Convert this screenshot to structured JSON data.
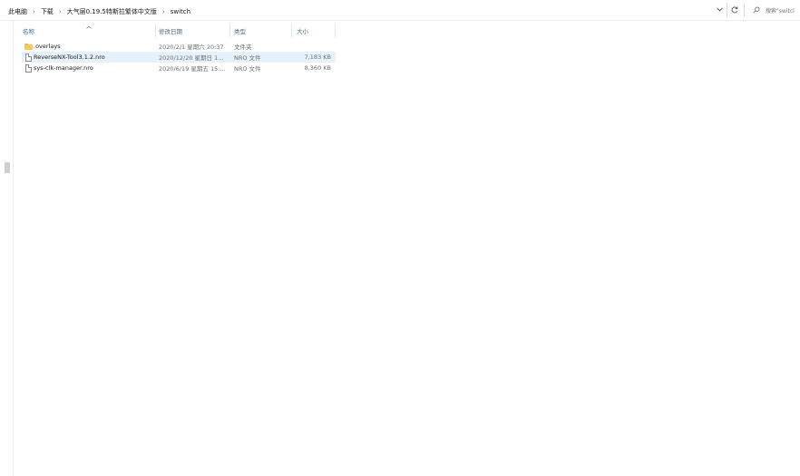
{
  "breadcrumb": {
    "items": [
      "此电脑",
      "下载",
      "大气层0.19.5特斯拉繁体中文版",
      "switch"
    ],
    "separator": "›"
  },
  "address_controls": {
    "dropdown_icon": "chevron-down-icon",
    "refresh_icon": "refresh-icon"
  },
  "search": {
    "placeholder": "搜索\"switcl",
    "icon": "search-icon"
  },
  "columns": {
    "name": "名称",
    "date": "修改日期",
    "type": "类型",
    "size": "大小"
  },
  "files": [
    {
      "name": ".overlays",
      "date": "2020/2/1 星期六 20:37",
      "type": "文件夹",
      "size": "",
      "icon": "folder-icon",
      "selected": false
    },
    {
      "name": "ReverseNX-Tool3.1.2.nro",
      "date": "2020/12/20 星期日 1...",
      "type": "NRO 文件",
      "size": "7,183 KB",
      "icon": "file-icon",
      "selected": true
    },
    {
      "name": "sys-clk-manager.nro",
      "date": "2020/6/19 星期五 15:...",
      "type": "NRO 文件",
      "size": "8,360 KB",
      "icon": "file-icon",
      "selected": false
    }
  ],
  "colors": {
    "selection": "#e5f1fb",
    "header_text": "#4d6b8a",
    "folder": "#f5c858"
  }
}
